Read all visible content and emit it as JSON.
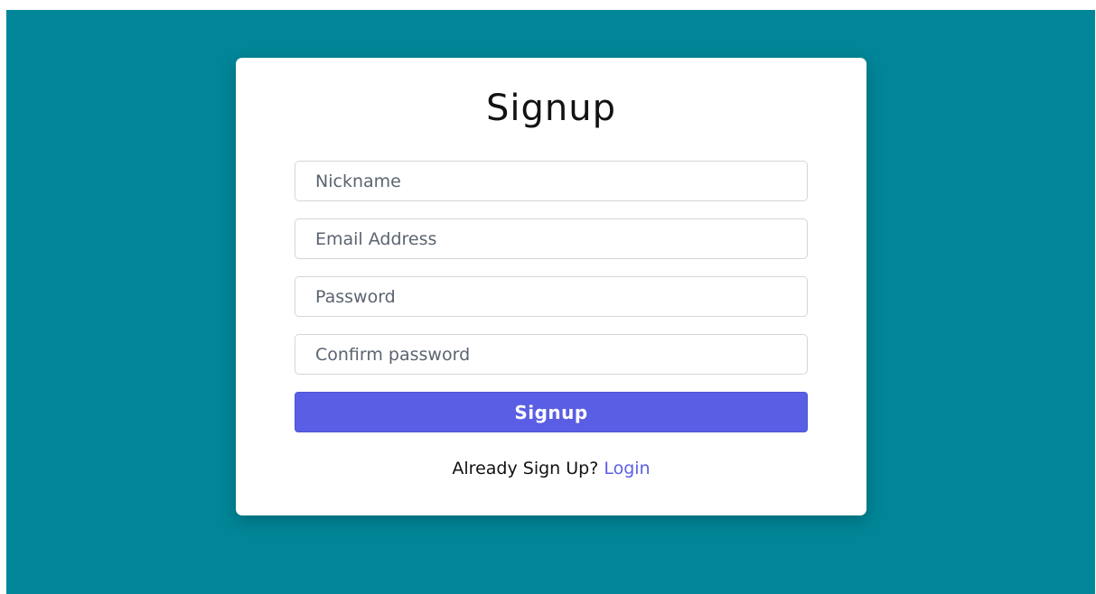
{
  "form": {
    "title": "Signup",
    "fields": [
      {
        "placeholder": "Nickname",
        "value": ""
      },
      {
        "placeholder": "Email Address",
        "value": ""
      },
      {
        "placeholder": "Password",
        "value": ""
      },
      {
        "placeholder": "Confirm password",
        "value": ""
      }
    ],
    "submit_label": "Signup",
    "footer_text": "Already Sign Up?",
    "login_link": "Login"
  },
  "colors": {
    "background": "#008698",
    "accent": "#5a5ee4",
    "link": "#5b5fe6"
  }
}
